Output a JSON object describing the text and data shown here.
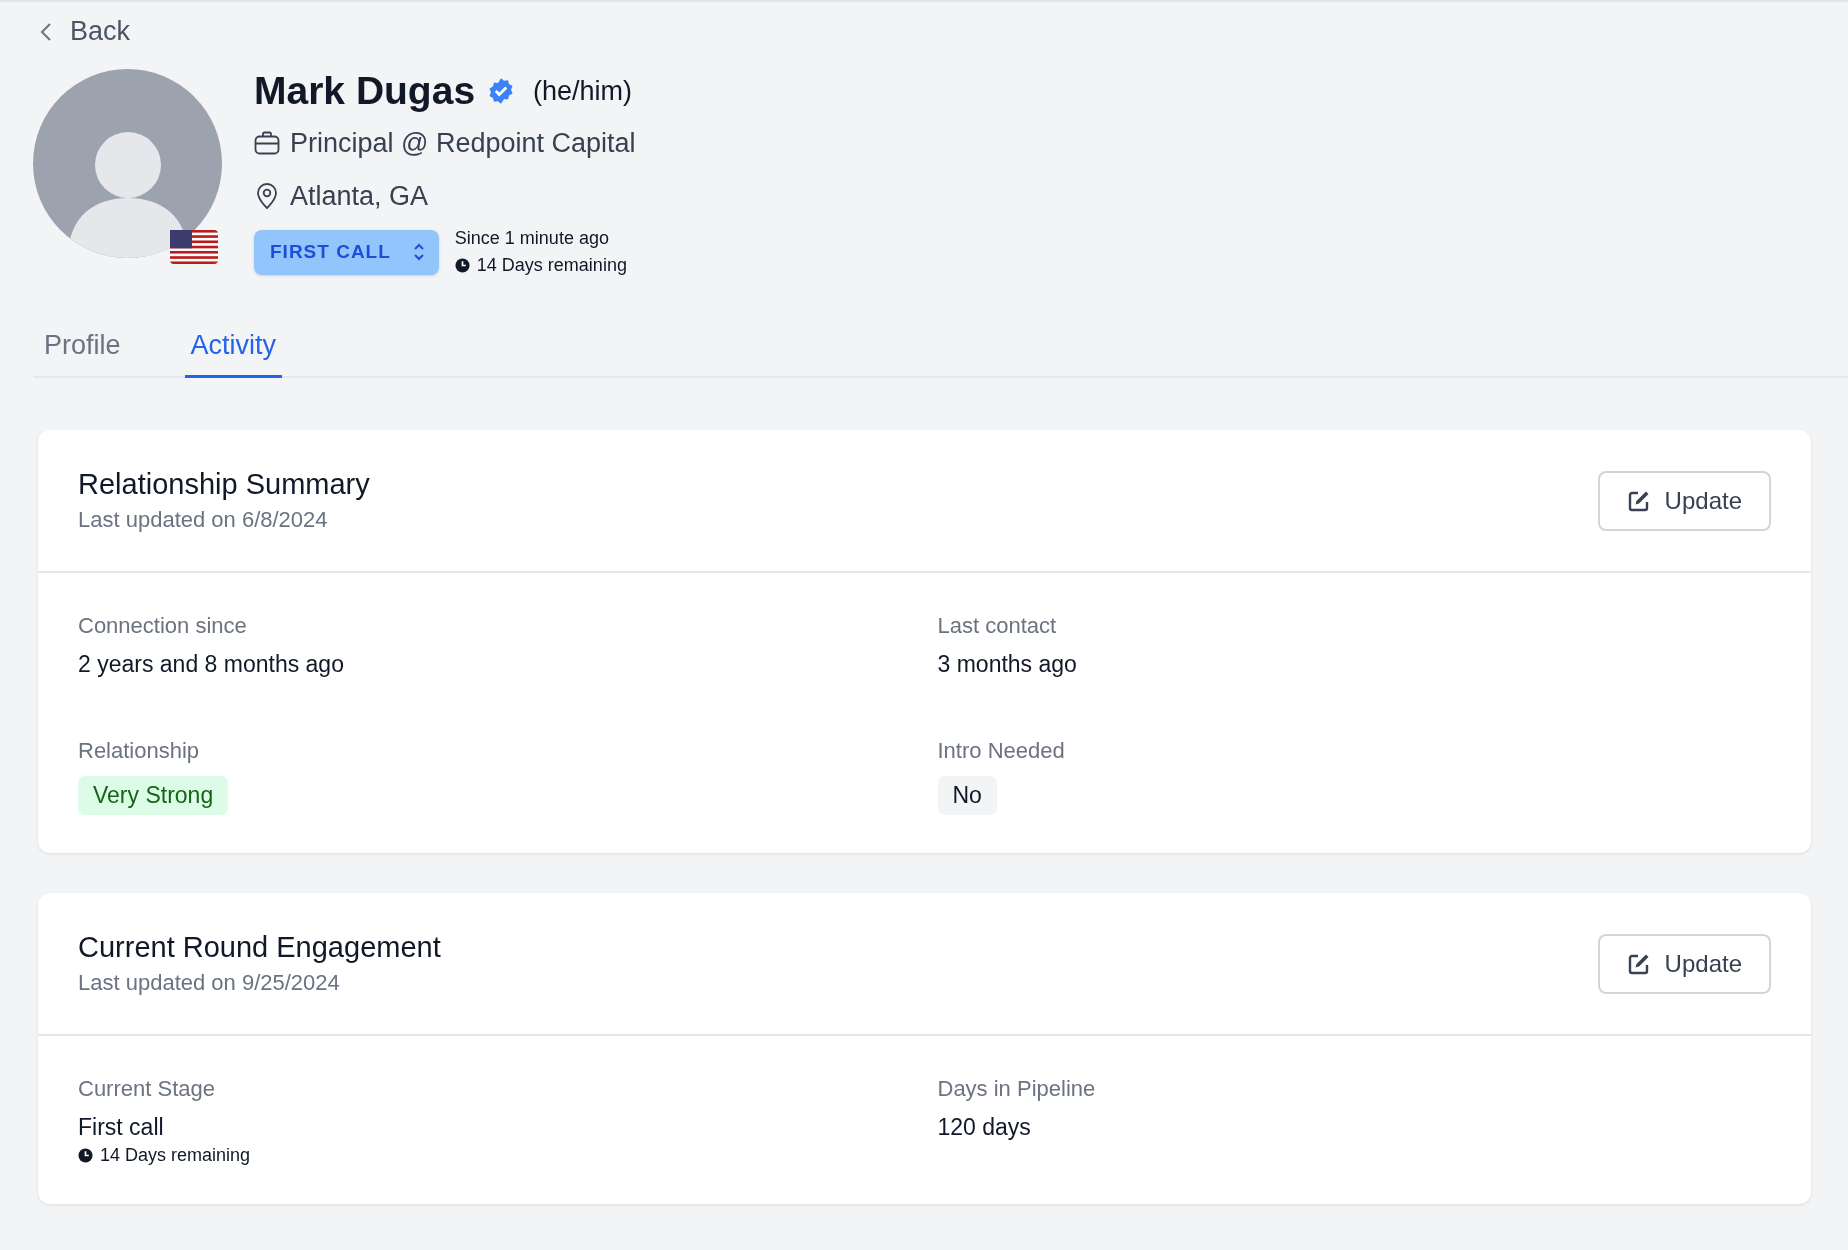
{
  "back": {
    "label": "Back"
  },
  "profile": {
    "name": "Mark Dugas",
    "verified": true,
    "pronouns": "(he/him)",
    "role": "Principal @ Redpoint Capital",
    "location": "Atlanta, GA",
    "stage": "FIRST CALL",
    "since": "Since 1 minute ago",
    "remaining": "14 Days remaining"
  },
  "tabs": [
    {
      "label": "Profile",
      "selected": false
    },
    {
      "label": "Activity",
      "selected": true
    }
  ],
  "cards": [
    {
      "title": "Relationship Summary",
      "updated": "Last updated on 6/8/2024",
      "button": "Update",
      "fields": [
        {
          "kind": "text",
          "label": "Connection since",
          "value": "2 years and 8 months ago"
        },
        {
          "kind": "text",
          "label": "Last contact",
          "value": "3 months ago"
        },
        {
          "kind": "badge",
          "color": "#dcfce7",
          "label": "Relationship",
          "value": "Very Strong"
        },
        {
          "kind": "badge",
          "color": "#f3f4f6",
          "label": "Intro Needed",
          "value": "No"
        }
      ]
    },
    {
      "title": "Current Round Engagement",
      "updated": "Last updated on 9/25/2024",
      "button": "Update",
      "fields": [
        {
          "kind": "text",
          "label": "Current Stage",
          "value": "First call",
          "note": "14 Days remaining"
        },
        {
          "kind": "text",
          "label": "Days in Pipeline",
          "value": "120 days"
        }
      ]
    }
  ]
}
